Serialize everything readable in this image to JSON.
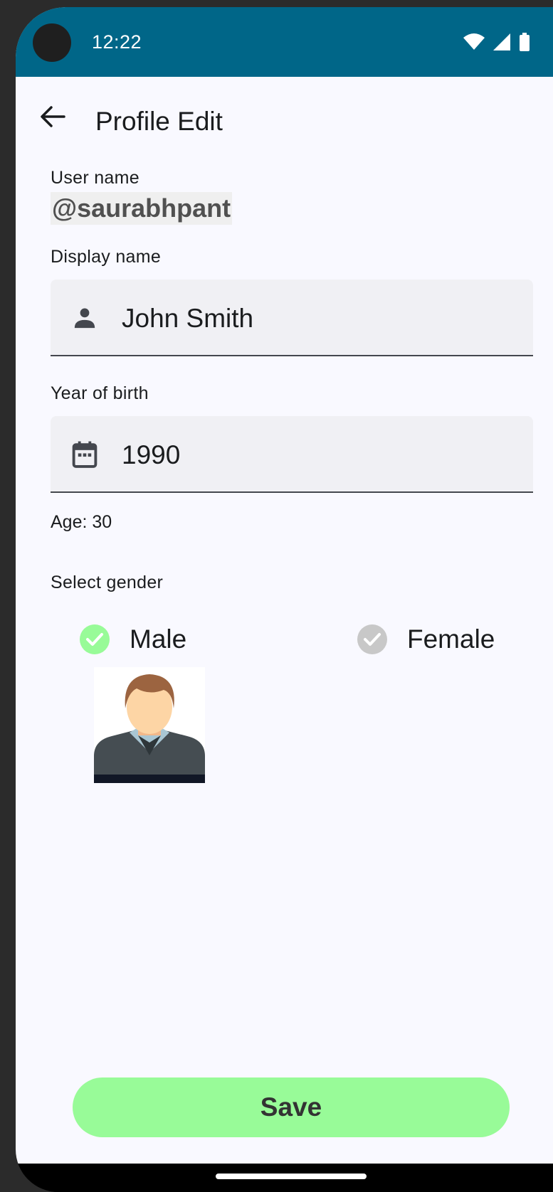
{
  "status_bar": {
    "time": "12:22",
    "icons": [
      "wifi-icon",
      "cellular-icon",
      "battery-icon"
    ]
  },
  "app_bar": {
    "title": "Profile Edit",
    "back_icon": "arrow-back-icon"
  },
  "user_name": {
    "label": "User name",
    "value": "@saurabhpant"
  },
  "display_name": {
    "label": "Display name",
    "value": "John Smith",
    "icon": "person-icon"
  },
  "year_of_birth": {
    "label": "Year of birth",
    "value": "1990",
    "icon": "calendar-icon"
  },
  "age_text": "Age: 30",
  "gender": {
    "label": "Select gender",
    "options": [
      {
        "label": "Male",
        "selected": true
      },
      {
        "label": "Female",
        "selected": false
      }
    ],
    "selected_color": "#98fb98",
    "unselected_color": "#c8c8c8"
  },
  "save_button": {
    "label": "Save",
    "color": "#98fb98"
  },
  "colors": {
    "status_bar": "#006688",
    "background": "#f9f9ff"
  }
}
